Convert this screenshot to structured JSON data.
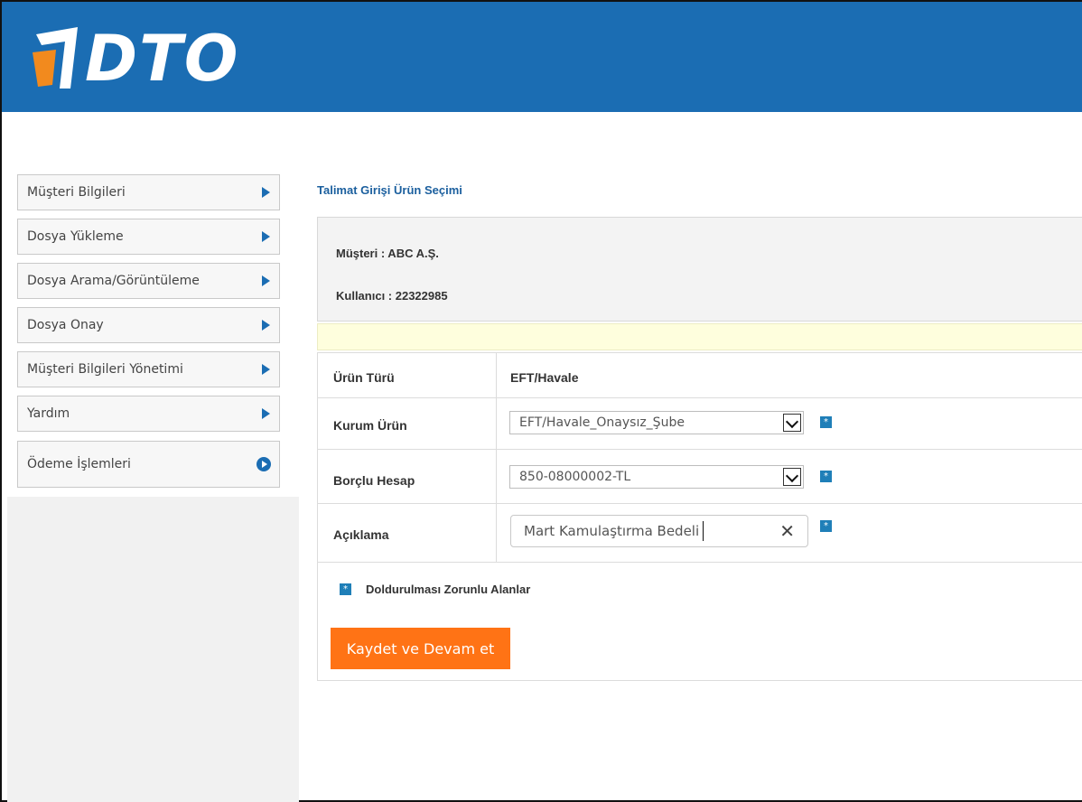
{
  "brand": {
    "logo_text": "DTO",
    "primary_color": "#1b6db3",
    "accent_color": "#ff7315"
  },
  "sidebar": {
    "items": [
      {
        "label": "Müşteri Bilgileri",
        "icon": "triangle-arrow-icon"
      },
      {
        "label": "Dosya Yükleme",
        "icon": "triangle-arrow-icon"
      },
      {
        "label": "Dosya Arama/Görüntüleme",
        "icon": "triangle-arrow-icon"
      },
      {
        "label": "Dosya Onay",
        "icon": "triangle-arrow-icon"
      },
      {
        "label": "Müşteri Bilgileri Yönetimi",
        "icon": "triangle-arrow-icon"
      },
      {
        "label": "Yardım",
        "icon": "triangle-arrow-icon"
      },
      {
        "label": "Ödeme İşlemleri",
        "icon": "circle-arrow-icon"
      }
    ]
  },
  "page": {
    "title": "Talimat Girişi Ürün Seçimi",
    "customer_line": "Müşteri :  ABC A.Ş.",
    "user_line": "Kullanıcı : 22322985"
  },
  "form": {
    "urun_turu": {
      "label": "Ürün Türü",
      "value": "EFT/Havale"
    },
    "kurum_urun": {
      "label": "Kurum Ürün",
      "value": "EFT/Havale_Onaysız_Şube"
    },
    "borclu_hesap": {
      "label": "Borçlu Hesap",
      "value": "850-08000002-TL"
    },
    "aciklama": {
      "label": "Açıklama",
      "value": "Mart Kamulaştırma Bedeli"
    },
    "required_marker": "*",
    "required_legend": "Doldurulması Zorunlu Alanlar",
    "submit_label": "Kaydet ve Devam et"
  }
}
